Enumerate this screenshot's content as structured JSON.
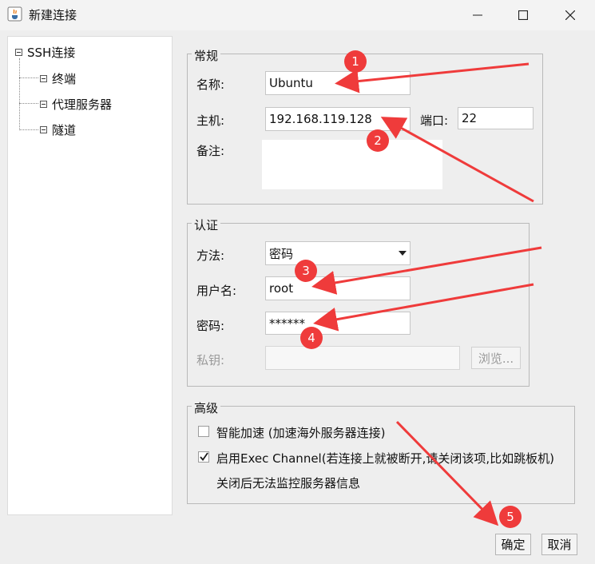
{
  "window": {
    "title": "新建连接",
    "controls": [
      "minimize-icon",
      "maximize-icon",
      "close-icon"
    ]
  },
  "tree": {
    "root": "SSH连接",
    "children": [
      "终端",
      "代理服务器",
      "隧道"
    ]
  },
  "general": {
    "legend": "常规",
    "name_label": "名称:",
    "name_value": "Ubuntu",
    "host_label": "主机:",
    "host_value": "192.168.119.128",
    "port_label": "端口:",
    "port_value": "22",
    "note_label": "备注:",
    "note_value": ""
  },
  "auth": {
    "legend": "认证",
    "method_label": "方法:",
    "method_value": "密码",
    "user_label": "用户名:",
    "user_value": "root",
    "password_label": "密码:",
    "password_value": "******",
    "key_label": "私钥:",
    "key_value": "",
    "browse_label": "浏览..."
  },
  "advanced": {
    "legend": "高级",
    "accelerate_label": "智能加速 (加速海外服务器连接)",
    "accelerate_checked": false,
    "exec_label": "启用Exec Channel(若连接上就被断开,请关闭该项,比如跳板机)",
    "exec_checked": true,
    "exec_note": "关闭后无法监控服务器信息"
  },
  "footer": {
    "ok_label": "确定",
    "cancel_label": "取消"
  },
  "annotations": [
    "1",
    "2",
    "3",
    "4",
    "5"
  ],
  "colors": {
    "annotation": "#ef3b3b",
    "check": "#1a1a1a"
  }
}
